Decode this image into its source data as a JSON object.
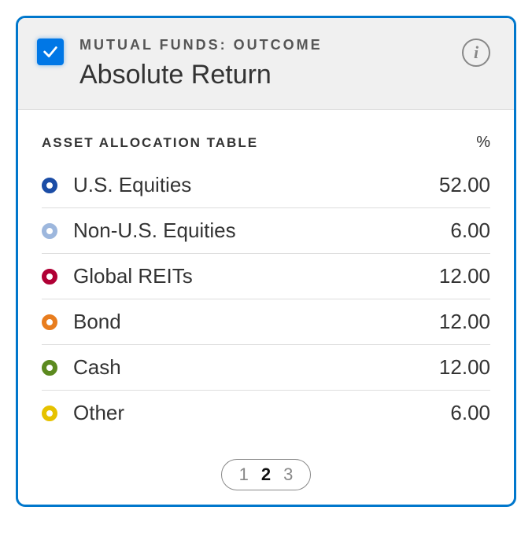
{
  "header": {
    "eyebrow": "MUTUAL FUNDS: OUTCOME",
    "title": "Absolute Return",
    "checked": true
  },
  "table": {
    "title": "ASSET ALLOCATION TABLE",
    "pct_header": "%",
    "rows": [
      {
        "label": "U.S. Equities",
        "value": "52.00",
        "color": "#1b4da6"
      },
      {
        "label": "Non-U.S. Equities",
        "value": "6.00",
        "color": "#9db7dd"
      },
      {
        "label": "Global REITs",
        "value": "12.00",
        "color": "#b00035"
      },
      {
        "label": "Bond",
        "value": "12.00",
        "color": "#e87d1e"
      },
      {
        "label": "Cash",
        "value": "12.00",
        "color": "#5c8a1f"
      },
      {
        "label": "Other",
        "value": "6.00",
        "color": "#e6c200"
      }
    ]
  },
  "pagination": {
    "pages": [
      "1",
      "2",
      "3"
    ],
    "active": "2"
  }
}
